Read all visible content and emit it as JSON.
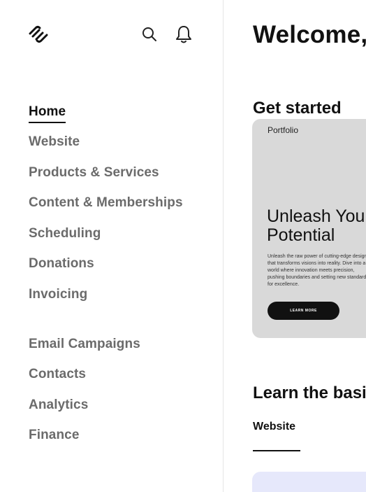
{
  "header": {
    "logo_icon": "squarespace-logo-icon",
    "search_icon": "search-icon",
    "notifications_icon": "bell-icon"
  },
  "sidebar": {
    "items": [
      {
        "label": "Home",
        "active": true
      },
      {
        "label": "Website"
      },
      {
        "label": "Products & Services"
      },
      {
        "label": "Content & Memberships"
      },
      {
        "label": "Scheduling"
      },
      {
        "label": "Donations"
      },
      {
        "label": "Invoicing"
      },
      {
        "label": "Email Campaigns"
      },
      {
        "label": "Contacts"
      },
      {
        "label": "Analytics"
      },
      {
        "label": "Finance"
      }
    ]
  },
  "main": {
    "welcome": "Welcome,",
    "get_started_title": "Get started",
    "template_card": {
      "tag": "Portfolio",
      "headline": "Unleash Your Design Potential",
      "body": "Unleash the raw power of cutting-edge design that transforms visions into reality. Dive into a world where innovation meets precision, pushing boundaries and setting new standards for excellence.",
      "button_label": "LEARN MORE"
    },
    "learn_basics_title": "Learn the basics",
    "tabs": [
      {
        "label": "Website",
        "active": true
      }
    ]
  },
  "colors": {
    "text_primary": "#111111",
    "text_muted": "#6b6b6b",
    "card_bg": "#d9d9d9",
    "accent_card_bg": "#e6e8fb"
  }
}
